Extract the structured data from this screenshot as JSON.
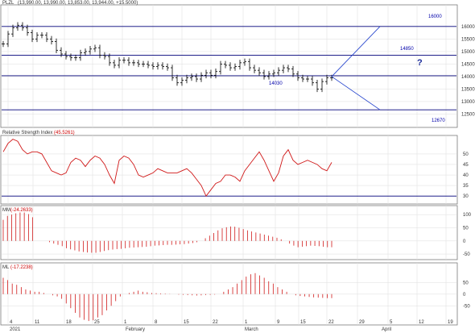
{
  "panels": {
    "price": {
      "header_label": "PLZL",
      "header_values": "(13,990.00, 13,990.00, 13,853.00, 13,944.00, +15.5000)"
    },
    "rsi": {
      "header_label": "Relative Strength Index",
      "header_value": "(45.5261)"
    },
    "mm": {
      "header_label": "MM",
      "header_value": "(-24.2633)"
    },
    "ml": {
      "header_label": "ML",
      "header_value": "(-17.2238)"
    }
  },
  "colors": {
    "background": "#ffffff",
    "grid": "#e3e3e3",
    "candles": "#000000",
    "levels": "#00007a",
    "projection": "#1f3fcc",
    "level_labels": "#0000aa",
    "question_mark": "#1a2a9a",
    "rsi_line": "#d01818",
    "histogram": "#d01818",
    "header_value": "#cc0000"
  },
  "chart_data": [
    {
      "type": "candlestick",
      "title": "PLZL",
      "ylim": [
        12000,
        16800
      ],
      "yticks": [
        12500,
        13000,
        13500,
        14000,
        14500,
        15000,
        15500,
        16000
      ],
      "horizontal_levels": [
        16000,
        14850,
        14030,
        12670
      ],
      "level_labels": [
        "16000",
        "14850",
        "14030",
        "12670"
      ],
      "annotation": "?",
      "projection": {
        "from": [
          68,
          14000
        ],
        "to_up": [
          78,
          16000
        ],
        "to_down": [
          78,
          12670
        ]
      },
      "closes": [
        15300,
        15700,
        15950,
        16050,
        15950,
        15750,
        15500,
        15650,
        15650,
        15500,
        15400,
        15050,
        14900,
        14800,
        14750,
        14750,
        14950,
        15000,
        15100,
        15150,
        14850,
        14800,
        14550,
        14450,
        14650,
        14650,
        14550,
        14550,
        14500,
        14500,
        14450,
        14400,
        14450,
        14400,
        14350,
        13950,
        13750,
        13850,
        13950,
        14000,
        13900,
        14050,
        14150,
        14050,
        14200,
        14500,
        14450,
        14350,
        14400,
        14550,
        14600,
        14350,
        14250,
        14150,
        14000,
        14100,
        14150,
        14250,
        14350,
        14300,
        14100,
        13950,
        13900,
        13900,
        13750,
        13500,
        13800,
        13950,
        13950
      ]
    },
    {
      "type": "line",
      "title": "Relative Strength Index",
      "ylim": [
        27,
        58
      ],
      "yticks": [
        30,
        35,
        40,
        45,
        50
      ],
      "x": [
        0,
        1,
        2,
        3,
        4,
        5,
        6,
        7,
        8,
        9,
        10,
        11,
        12,
        13,
        14,
        15,
        16,
        17,
        18,
        19,
        20,
        21,
        22,
        23,
        24,
        25,
        26,
        27,
        28,
        29,
        30,
        31,
        32,
        33,
        34,
        35,
        36,
        37,
        38,
        39,
        40,
        41,
        42,
        43,
        44,
        45,
        46,
        47,
        48,
        49,
        50,
        51,
        52,
        53,
        54,
        55,
        56,
        57,
        58,
        59,
        60,
        61,
        62,
        63,
        64,
        65,
        66,
        67,
        68
      ],
      "values": [
        51,
        55,
        57,
        56,
        52,
        50,
        51,
        51,
        50,
        46,
        42,
        41,
        40,
        41,
        46,
        48,
        47,
        44,
        47,
        49,
        48,
        45,
        40,
        36,
        47,
        49,
        48,
        45,
        40,
        39,
        40,
        41,
        43,
        42,
        41,
        41,
        41,
        42,
        43,
        41,
        38,
        35,
        30,
        33,
        36,
        37,
        40,
        40,
        39,
        37,
        42,
        45,
        48,
        51,
        47,
        42,
        37,
        41,
        49,
        52,
        47,
        45,
        46,
        47,
        46,
        45,
        43,
        42,
        46
      ]
    },
    {
      "type": "bar",
      "title": "MM",
      "ylim": [
        -65,
        125
      ],
      "yticks": [
        -50,
        0,
        50,
        100
      ],
      "values": [
        80,
        95,
        100,
        105,
        108,
        108,
        102,
        90,
        0,
        0,
        0,
        -5,
        -10,
        -15,
        -20,
        -28,
        -32,
        -36,
        -40,
        -42,
        -44,
        -45,
        -45,
        -42,
        -38,
        -35,
        -33,
        -31,
        -30,
        -28,
        -26,
        -25,
        -24,
        -23,
        -22,
        -20,
        -18,
        -17,
        -16,
        -15,
        -15,
        -14,
        -13,
        -12,
        -10,
        -8,
        -5,
        0,
        10,
        20,
        30,
        40,
        48,
        52,
        55,
        54,
        50,
        45,
        40,
        36,
        32,
        28,
        24,
        20,
        16,
        12,
        6,
        0,
        -10,
        -18,
        -24,
        -22,
        -20,
        -18,
        -19,
        -20,
        -22,
        -24,
        -24
      ]
    },
    {
      "type": "bar",
      "title": "ML",
      "ylim": [
        -125,
        120
      ],
      "yticks": [
        -50,
        0,
        50
      ],
      "values": [
        70,
        60,
        45,
        40,
        30,
        20,
        15,
        10,
        10,
        5,
        0,
        -5,
        -10,
        -20,
        -40,
        -60,
        -80,
        -100,
        -110,
        -115,
        -112,
        -100,
        -90,
        -70,
        -50,
        -30,
        -10,
        0,
        5,
        10,
        15,
        10,
        8,
        5,
        4,
        3,
        2,
        1,
        0,
        -2,
        -3,
        -4,
        -5,
        -6,
        -5,
        -4,
        -3,
        -2,
        0,
        10,
        20,
        30,
        45,
        60,
        75,
        85,
        90,
        80,
        70,
        55,
        45,
        30,
        20,
        10,
        0,
        -5,
        -8,
        -10,
        -12,
        -14,
        -15,
        -16,
        -17,
        -17
      ]
    }
  ],
  "x_axis": {
    "day_labels": [
      "4",
      "11",
      "18",
      "25",
      "1",
      "8",
      "15",
      "22",
      "1",
      "9",
      "15",
      "22",
      "29",
      "5",
      "12",
      "19"
    ],
    "month_labels": [
      "2021",
      "February",
      "March",
      "April"
    ]
  }
}
